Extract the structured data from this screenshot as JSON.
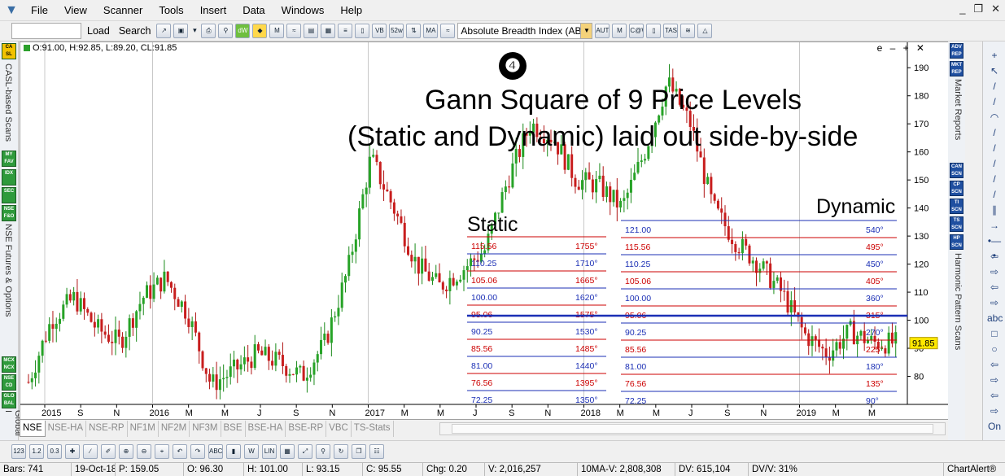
{
  "menu": [
    "File",
    "View",
    "Scanner",
    "Tools",
    "Insert",
    "Data",
    "Windows",
    "Help"
  ],
  "window_controls": [
    "_",
    "❐",
    "✕"
  ],
  "toolbar": {
    "load_label": "Load",
    "search_label": "Search",
    "indicator_select": "Absolute Breadth Index (ABI",
    "icon_labels": [
      "52w Hi/Lo",
      "MA",
      "AUTO FIBO",
      "M PVT",
      "C@W TAM",
      "TAS"
    ]
  },
  "left_panel": {
    "buttons": [
      "CA SL",
      "MY FAV",
      "IDX",
      "SEC",
      "NSE F&O",
      "MCX NCX",
      "NSE CD",
      "GLO BAL"
    ],
    "vertical_labels": [
      "CASL-based Scans",
      "NSE Futures & Options",
      "Global I"
    ]
  },
  "chart": {
    "ohlc": "O:91.00, H:92.85, L:89.20, CL:91.85",
    "controls": "e – + ✕",
    "annotation_number": "❹",
    "title_line1": "Gann Square of 9 Price Levels",
    "title_line2": "(Static and Dynamic) laid out side-by-side",
    "static_label": "Static",
    "dynamic_label": "Dynamic",
    "last_price": "91.85",
    "y_ticks": [
      "190",
      "180",
      "170",
      "160",
      "150",
      "140",
      "130",
      "120",
      "110",
      "100",
      "90",
      "80"
    ],
    "x_ticks": [
      "2015",
      "S",
      "N",
      "2016",
      "M",
      "M",
      "J",
      "S",
      "N",
      "2017",
      "M",
      "M",
      "J",
      "S",
      "N",
      "2018",
      "M",
      "M",
      "J",
      "S",
      "N",
      "2019",
      "M",
      "M"
    ]
  },
  "static_levels": [
    {
      "price": "115.56",
      "angle": "1755°",
      "color": "#cc0000"
    },
    {
      "price": "110.25",
      "angle": "1710°",
      "color": "#1b2fb5"
    },
    {
      "price": "105.06",
      "angle": "1665°",
      "color": "#cc0000"
    },
    {
      "price": "100.00",
      "angle": "1620°",
      "color": "#1b2fb5"
    },
    {
      "price": "95.06",
      "angle": "1575°",
      "color": "#cc0000"
    },
    {
      "price": "90.25",
      "angle": "1530°",
      "color": "#1b2fb5"
    },
    {
      "price": "85.56",
      "angle": "1485°",
      "color": "#cc0000"
    },
    {
      "price": "81.00",
      "angle": "1440°",
      "color": "#1b2fb5"
    },
    {
      "price": "76.56",
      "angle": "1395°",
      "color": "#cc0000"
    },
    {
      "price": "72.25",
      "angle": "1350°",
      "color": "#1b2fb5"
    }
  ],
  "dynamic_levels": [
    {
      "price": "121.00",
      "angle": "540°",
      "color": "#1b2fb5"
    },
    {
      "price": "115.56",
      "angle": "495°",
      "color": "#cc0000"
    },
    {
      "price": "110.25",
      "angle": "450°",
      "color": "#1b2fb5"
    },
    {
      "price": "105.06",
      "angle": "405°",
      "color": "#cc0000"
    },
    {
      "price": "100.00",
      "angle": "360°",
      "color": "#1b2fb5"
    },
    {
      "price": "95.06",
      "angle": "315°",
      "color": "#cc0000"
    },
    {
      "price": "90.25",
      "angle": "270°",
      "color": "#1b2fb5"
    },
    {
      "price": "85.56",
      "angle": "225°",
      "color": "#cc0000"
    },
    {
      "price": "81.00",
      "angle": "180°",
      "color": "#1b2fb5"
    },
    {
      "price": "76.56",
      "angle": "135°",
      "color": "#cc0000"
    },
    {
      "price": "72.25",
      "angle": "90°",
      "color": "#1b2fb5"
    }
  ],
  "right_panel": {
    "buttons": [
      "ADV REP",
      "MKT REP",
      "CAN SCN",
      "CP SCN",
      "TI SCN",
      "TS SCN",
      "HP SCN"
    ],
    "vertical_labels": [
      "Market Reports",
      "Harmonic Pattern Scans"
    ]
  },
  "draw_tools": [
    "+",
    "↖",
    "/",
    "/",
    "◠",
    "/",
    "/",
    "/",
    "/",
    "/",
    "∥",
    "→",
    "•—•",
    "⇦",
    "⇨",
    "⇦",
    "⇨",
    "abc",
    "□",
    "○",
    "⇦",
    "⇨",
    "⇦",
    "⇨",
    "On"
  ],
  "tabs": [
    "NSE",
    "NSE-HA",
    "NSE-RP",
    "NF1M",
    "NF2M",
    "NF3M",
    "BSE",
    "BSE-HA",
    "BSE-RP",
    "VBC",
    "TS-Stats"
  ],
  "status": {
    "bars": "Bars: 741",
    "date": "19-Oct-18",
    "open": "O: 96.30",
    "high": "H: 101.00",
    "prev": "P: 159.05",
    "low": "L: 93.15",
    "close": "C: 95.55",
    "chg": "Chg: 0.20",
    "volume": "V: 2,016,257",
    "ma_volume": "10MA-V: 2,808,308",
    "dv": "DV: 615,104",
    "dvv": "DV/V: 31%",
    "brand": "ChartAlert®"
  },
  "chart_data": {
    "type": "candlestick",
    "y_range": [
      70,
      195
    ],
    "approx_closes_monthly": [
      78,
      100,
      108,
      97,
      92,
      108,
      115,
      102,
      77,
      82,
      88,
      85,
      80,
      92,
      118,
      158,
      140,
      120,
      112,
      118,
      125,
      150,
      170,
      165,
      150,
      148,
      140,
      160,
      185,
      170,
      140,
      128,
      120,
      110,
      95,
      88,
      96,
      92,
      91.85
    ]
  }
}
